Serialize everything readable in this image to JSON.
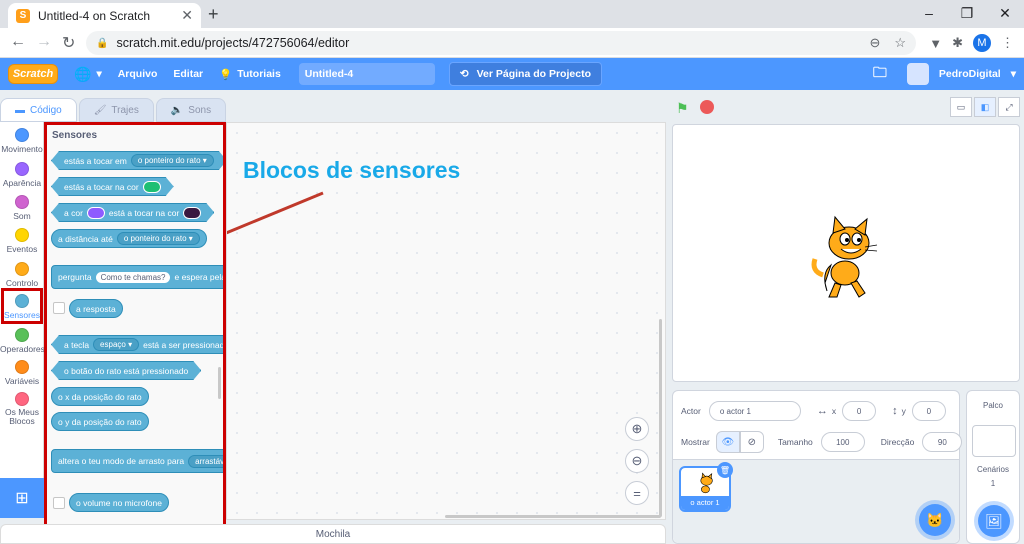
{
  "browser": {
    "tab_title": "Untitled-4 on Scratch",
    "tab_favicon": "S",
    "url": "scratch.mit.edu/projects/472756064/editor",
    "profile_initial": "M"
  },
  "menubar": {
    "logo": "Scratch",
    "file": "Arquivo",
    "edit": "Editar",
    "tutorials": "Tutoriais",
    "project_title": "Untitled-4",
    "share_page": "Ver Página do Projecto",
    "username": "PedroDigital"
  },
  "editor_tabs": {
    "code": "Código",
    "costumes": "Trajes",
    "sounds": "Sons"
  },
  "categories": [
    {
      "label": "Movimento",
      "color": "#4c97ff"
    },
    {
      "label": "Aparência",
      "color": "#9966ff"
    },
    {
      "label": "Som",
      "color": "#cf63cf"
    },
    {
      "label": "Eventos",
      "color": "#ffd500"
    },
    {
      "label": "Controlo",
      "color": "#ffab19"
    },
    {
      "label": "Sensores",
      "color": "#5cb1d6"
    },
    {
      "label": "Operadores",
      "color": "#59c059"
    },
    {
      "label": "Variáveis",
      "color": "#ff8c1a"
    },
    {
      "label": "Os Meus Blocos",
      "color": "#ff6680"
    }
  ],
  "palette": {
    "title": "Sensores",
    "touching_pre": "estás a tocar em",
    "touching_dd": "o ponteiro do rato",
    "touching_color": "estás a tocar na cor",
    "color_a": "a cor",
    "color_b": "está a tocar na cor",
    "distance_pre": "a distância até",
    "distance_dd": "o ponteiro do rato",
    "ask_pre": "pergunta",
    "ask_field": "Como te chamas?",
    "ask_post": "e espera pela resposta",
    "answer": "a resposta",
    "key_pre": "a tecla",
    "key_dd": "espaço",
    "key_post": "está a ser pressionada",
    "mouse_down": "o botão do rato está pressionado",
    "mouse_x": "o x da posição do rato",
    "mouse_y": "o y da posição do rato",
    "drag_pre": "altera o teu modo de arrasto para",
    "drag_dd": "arrastável",
    "loudness": "o volume no microfone"
  },
  "annotation": "Blocos de sensores",
  "backpack": "Mochila",
  "sprite_info": {
    "sprite_label": "Actor",
    "sprite_name": "o actor 1",
    "x_label": "x",
    "x_value": "0",
    "y_label": "y",
    "y_value": "0",
    "show_label": "Mostrar",
    "size_label": "Tamanho",
    "size_value": "100",
    "direction_label": "Direcção",
    "direction_value": "90",
    "tile_label": "o actor 1"
  },
  "stage_pane": {
    "title": "Palco",
    "backdrops_label": "Cenários",
    "backdrops_count": "1"
  }
}
